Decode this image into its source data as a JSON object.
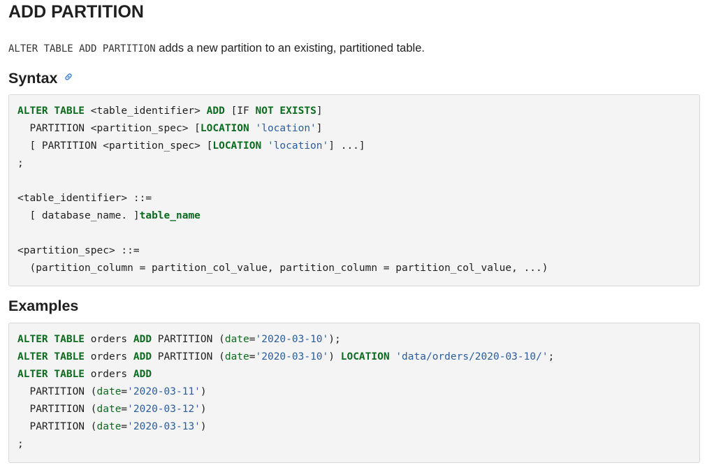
{
  "page": {
    "title": "ADD PARTITION",
    "intro_code": "ALTER TABLE ADD PARTITION",
    "intro_text": " adds a new partition to an existing, partitioned table.",
    "syntax_heading": "Syntax",
    "examples_heading": "Examples",
    "anchor_icon": "link-icon"
  },
  "syntax_lines": [
    [
      {
        "t": "ALTER TABLE",
        "c": "kw"
      },
      {
        "t": " <table_identifier> "
      },
      {
        "t": "ADD",
        "c": "kw"
      },
      {
        "t": " [IF "
      },
      {
        "t": "NOT EXISTS",
        "c": "kw"
      },
      {
        "t": "]"
      }
    ],
    [
      {
        "t": "  PARTITION <partition_spec> ["
      },
      {
        "t": "LOCATION",
        "c": "kw"
      },
      {
        "t": " "
      },
      {
        "t": "'location'",
        "c": "str"
      },
      {
        "t": "]"
      }
    ],
    [
      {
        "t": "  [ PARTITION <partition_spec> ["
      },
      {
        "t": "LOCATION",
        "c": "kw"
      },
      {
        "t": " "
      },
      {
        "t": "'location'",
        "c": "str"
      },
      {
        "t": "] ...]"
      }
    ],
    [
      {
        "t": ";"
      }
    ],
    [
      {
        "t": ""
      }
    ],
    [
      {
        "t": "<table_identifier> ::="
      }
    ],
    [
      {
        "t": "  [ database_name. ]"
      },
      {
        "t": "table_name",
        "c": "fn"
      }
    ],
    [
      {
        "t": ""
      }
    ],
    [
      {
        "t": "<partition_spec> ::="
      }
    ],
    [
      {
        "t": "  (partition_column = partition_col_value, partition_column = partition_col_value, ...)"
      }
    ]
  ],
  "example_lines": [
    [
      {
        "t": "ALTER TABLE",
        "c": "kw"
      },
      {
        "t": " orders "
      },
      {
        "t": "ADD",
        "c": "kw"
      },
      {
        "t": " PARTITION ("
      },
      {
        "t": "date",
        "c": "col"
      },
      {
        "t": "="
      },
      {
        "t": "'2020-03-10'",
        "c": "str"
      },
      {
        "t": ");"
      }
    ],
    [
      {
        "t": "ALTER TABLE",
        "c": "kw"
      },
      {
        "t": " orders "
      },
      {
        "t": "ADD",
        "c": "kw"
      },
      {
        "t": " PARTITION ("
      },
      {
        "t": "date",
        "c": "col"
      },
      {
        "t": "="
      },
      {
        "t": "'2020-03-10'",
        "c": "str"
      },
      {
        "t": ") "
      },
      {
        "t": "LOCATION",
        "c": "kw"
      },
      {
        "t": " "
      },
      {
        "t": "'data/orders/2020-03-10/'",
        "c": "str"
      },
      {
        "t": ";"
      }
    ],
    [
      {
        "t": "ALTER TABLE",
        "c": "kw"
      },
      {
        "t": " orders "
      },
      {
        "t": "ADD",
        "c": "kw"
      }
    ],
    [
      {
        "t": "  PARTITION ("
      },
      {
        "t": "date",
        "c": "col"
      },
      {
        "t": "="
      },
      {
        "t": "'2020-03-11'",
        "c": "str"
      },
      {
        "t": ")"
      }
    ],
    [
      {
        "t": "  PARTITION ("
      },
      {
        "t": "date",
        "c": "col"
      },
      {
        "t": "="
      },
      {
        "t": "'2020-03-12'",
        "c": "str"
      },
      {
        "t": ")"
      }
    ],
    [
      {
        "t": "  PARTITION ("
      },
      {
        "t": "date",
        "c": "col"
      },
      {
        "t": "="
      },
      {
        "t": "'2020-03-13'",
        "c": "str"
      },
      {
        "t": ")"
      }
    ],
    [
      {
        "t": ";"
      }
    ]
  ],
  "colors": {
    "keyword": "#0b6b1e",
    "string": "#2a5d9a",
    "code_background": "#f4f4f4",
    "link_icon": "#2f7fd6"
  }
}
